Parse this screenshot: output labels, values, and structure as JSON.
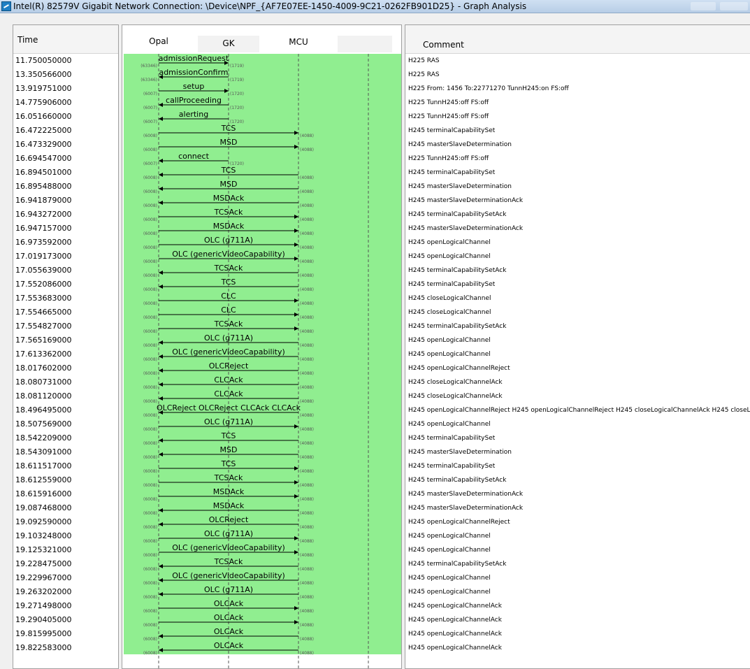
{
  "window": {
    "title": "Intel(R) 82579V Gigabit Network Connection: \\Device\\NPF_{AF7E07EE-1450-4009-9C21-0262FB901D25} - Graph Analysis"
  },
  "colors": {
    "graph_bg": "#90ee90",
    "line": "#000000"
  },
  "headers": {
    "time": "Time",
    "comment": "Comment"
  },
  "nodes": [
    "Opal",
    "GK",
    "MCU",
    ""
  ],
  "rows": [
    {
      "time": "11.750050000",
      "from": 0,
      "to": 1,
      "label": "admissionRequest",
      "pl": "(63346)",
      "pr": "(1719)",
      "comment": "H225 RAS"
    },
    {
      "time": "13.350566000",
      "from": 1,
      "to": 0,
      "label": "admissionConfirm",
      "pl": "(63346)",
      "pr": "(1719)",
      "comment": "H225 RAS"
    },
    {
      "time": "13.919751000",
      "from": 0,
      "to": 1,
      "label": "setup",
      "pl": "(6007)",
      "pr": "(1720)",
      "comment": "H225 From: 1456 To:22771270  TunnH245:on FS:off"
    },
    {
      "time": "14.775906000",
      "from": 1,
      "to": 0,
      "label": "callProceeding",
      "pl": "(6007)",
      "pr": "(1720)",
      "comment": "H225 TunnH245:off FS:off"
    },
    {
      "time": "16.051660000",
      "from": 1,
      "to": 0,
      "label": "alerting",
      "pl": "(6007)",
      "pr": "(1720)",
      "comment": "H225 TunnH245:off FS:off"
    },
    {
      "time": "16.472225000",
      "from": 0,
      "to": 2,
      "label": "TCS",
      "pl": "(6008)",
      "pr": "(4088)",
      "comment": "H245 terminalCapabilitySet"
    },
    {
      "time": "16.473329000",
      "from": 0,
      "to": 2,
      "label": "MSD",
      "pl": "(6008)",
      "pr": "(4088)",
      "comment": "H245 masterSlaveDetermination"
    },
    {
      "time": "16.694547000",
      "from": 1,
      "to": 0,
      "label": "connect",
      "pl": "(6007)",
      "pr": "(1720)",
      "comment": "H225 TunnH245:off FS:off"
    },
    {
      "time": "16.894501000",
      "from": 2,
      "to": 0,
      "label": "TCS",
      "pl": "(6008)",
      "pr": "(4088)",
      "comment": "H245 terminalCapabilitySet"
    },
    {
      "time": "16.895488000",
      "from": 2,
      "to": 0,
      "label": "MSD",
      "pl": "(6008)",
      "pr": "(4088)",
      "comment": "H245 masterSlaveDetermination"
    },
    {
      "time": "16.941879000",
      "from": 2,
      "to": 0,
      "label": "MSDAck",
      "pl": "(6008)",
      "pr": "(4088)",
      "comment": "H245 masterSlaveDeterminationAck"
    },
    {
      "time": "16.943272000",
      "from": 0,
      "to": 2,
      "label": "TCSAck",
      "pl": "(6008)",
      "pr": "(4088)",
      "comment": "H245 terminalCapabilitySetAck"
    },
    {
      "time": "16.947157000",
      "from": 0,
      "to": 2,
      "label": "MSDAck",
      "pl": "(6008)",
      "pr": "(4088)",
      "comment": "H245 masterSlaveDeterminationAck"
    },
    {
      "time": "16.973592000",
      "from": 0,
      "to": 2,
      "label": "OLC (g711A)",
      "pl": "(6008)",
      "pr": "(4088)",
      "comment": "H245 openLogicalChannel"
    },
    {
      "time": "17.019173000",
      "from": 0,
      "to": 2,
      "label": "OLC (genericVideoCapability)",
      "pl": "(6008)",
      "pr": "(4088)",
      "comment": "H245 openLogicalChannel"
    },
    {
      "time": "17.055639000",
      "from": 2,
      "to": 0,
      "label": "TCSAck",
      "pl": "(6008)",
      "pr": "(4088)",
      "comment": "H245 terminalCapabilitySetAck"
    },
    {
      "time": "17.552086000",
      "from": 2,
      "to": 0,
      "label": "TCS",
      "pl": "(6008)",
      "pr": "(4088)",
      "comment": "H245 terminalCapabilitySet"
    },
    {
      "time": "17.553683000",
      "from": 0,
      "to": 2,
      "label": "CLC",
      "pl": "(6008)",
      "pr": "(4088)",
      "comment": "H245 closeLogicalChannel"
    },
    {
      "time": "17.554665000",
      "from": 0,
      "to": 2,
      "label": "CLC",
      "pl": "(6008)",
      "pr": "(4088)",
      "comment": "H245 closeLogicalChannel"
    },
    {
      "time": "17.554827000",
      "from": 0,
      "to": 2,
      "label": "TCSAck",
      "pl": "(6008)",
      "pr": "(4088)",
      "comment": "H245 terminalCapabilitySetAck"
    },
    {
      "time": "17.565169000",
      "from": 2,
      "to": 0,
      "label": "OLC (g711A)",
      "pl": "(6008)",
      "pr": "(4088)",
      "comment": "H245 openLogicalChannel"
    },
    {
      "time": "17.613362000",
      "from": 2,
      "to": 0,
      "label": "OLC (genericVideoCapability)",
      "pl": "(6008)",
      "pr": "(4088)",
      "comment": "H245 openLogicalChannel"
    },
    {
      "time": "18.017602000",
      "from": 2,
      "to": 0,
      "label": "OLCReject",
      "pl": "(6008)",
      "pr": "(4088)",
      "comment": "H245 openLogicalChannelReject"
    },
    {
      "time": "18.080731000",
      "from": 2,
      "to": 0,
      "label": "CLCAck",
      "pl": "(6008)",
      "pr": "(4088)",
      "comment": "H245 closeLogicalChannelAck"
    },
    {
      "time": "18.081120000",
      "from": 2,
      "to": 0,
      "label": "CLCAck",
      "pl": "(6008)",
      "pr": "(4088)",
      "comment": "H245 closeLogicalChannelAck"
    },
    {
      "time": "18.496495000",
      "from": 2,
      "to": 0,
      "label": "OLCReject OLCReject CLCAck CLCAck",
      "pl": "(6008)",
      "pr": "(4088)",
      "comment": "H245 openLogicalChannelReject H245 openLogicalChannelReject H245 closeLogicalChannelAck H245 closeL"
    },
    {
      "time": "18.507569000",
      "from": 0,
      "to": 2,
      "label": "OLC (g711A)",
      "pl": "(6008)",
      "pr": "(4088)",
      "comment": "H245 openLogicalChannel"
    },
    {
      "time": "18.542209000",
      "from": 2,
      "to": 0,
      "label": "TCS",
      "pl": "(6008)",
      "pr": "(4088)",
      "comment": "H245 terminalCapabilitySet"
    },
    {
      "time": "18.543091000",
      "from": 2,
      "to": 0,
      "label": "MSD",
      "pl": "(6008)",
      "pr": "(4088)",
      "comment": "H245 masterSlaveDetermination"
    },
    {
      "time": "18.611517000",
      "from": 0,
      "to": 2,
      "label": "TCS",
      "pl": "(6008)",
      "pr": "(4088)",
      "comment": "H245 terminalCapabilitySet"
    },
    {
      "time": "18.612559000",
      "from": 0,
      "to": 2,
      "label": "TCSAck",
      "pl": "(6008)",
      "pr": "(4088)",
      "comment": "H245 terminalCapabilitySetAck"
    },
    {
      "time": "18.615916000",
      "from": 0,
      "to": 2,
      "label": "MSDAck",
      "pl": "(6008)",
      "pr": "(4088)",
      "comment": "H245 masterSlaveDeterminationAck"
    },
    {
      "time": "19.087468000",
      "from": 2,
      "to": 0,
      "label": "MSDAck",
      "pl": "(6008)",
      "pr": "(4088)",
      "comment": "H245 masterSlaveDeterminationAck"
    },
    {
      "time": "19.092590000",
      "from": 2,
      "to": 0,
      "label": "OLCReject",
      "pl": "(6008)",
      "pr": "(4088)",
      "comment": "H245 openLogicalChannelReject"
    },
    {
      "time": "19.103248000",
      "from": 0,
      "to": 2,
      "label": "OLC (g711A)",
      "pl": "(6008)",
      "pr": "(4088)",
      "comment": "H245 openLogicalChannel"
    },
    {
      "time": "19.125321000",
      "from": 0,
      "to": 2,
      "label": "OLC (genericVideoCapability)",
      "pl": "(6008)",
      "pr": "(4088)",
      "comment": "H245 openLogicalChannel"
    },
    {
      "time": "19.228475000",
      "from": 2,
      "to": 0,
      "label": "TCSAck",
      "pl": "(6008)",
      "pr": "(4088)",
      "comment": "H245 terminalCapabilitySetAck"
    },
    {
      "time": "19.229967000",
      "from": 2,
      "to": 0,
      "label": "OLC (genericVideoCapability)",
      "pl": "(6008)",
      "pr": "(4088)",
      "comment": "H245 openLogicalChannel"
    },
    {
      "time": "19.263202000",
      "from": 2,
      "to": 0,
      "label": "OLC (g711A)",
      "pl": "(6008)",
      "pr": "(4088)",
      "comment": "H245 openLogicalChannel"
    },
    {
      "time": "19.271498000",
      "from": 0,
      "to": 2,
      "label": "OLCAck",
      "pl": "(6008)",
      "pr": "(4088)",
      "comment": "H245 openLogicalChannelAck"
    },
    {
      "time": "19.290405000",
      "from": 0,
      "to": 2,
      "label": "OLCAck",
      "pl": "(6008)",
      "pr": "(4088)",
      "comment": "H245 openLogicalChannelAck"
    },
    {
      "time": "19.815995000",
      "from": 2,
      "to": 0,
      "label": "OLCAck",
      "pl": "(6008)",
      "pr": "(4088)",
      "comment": "H245 openLogicalChannelAck"
    },
    {
      "time": "19.822583000",
      "from": 2,
      "to": 0,
      "label": "OLCAck",
      "pl": "(6008)",
      "pr": "(4088)",
      "comment": "H245 openLogicalChannelAck"
    }
  ]
}
